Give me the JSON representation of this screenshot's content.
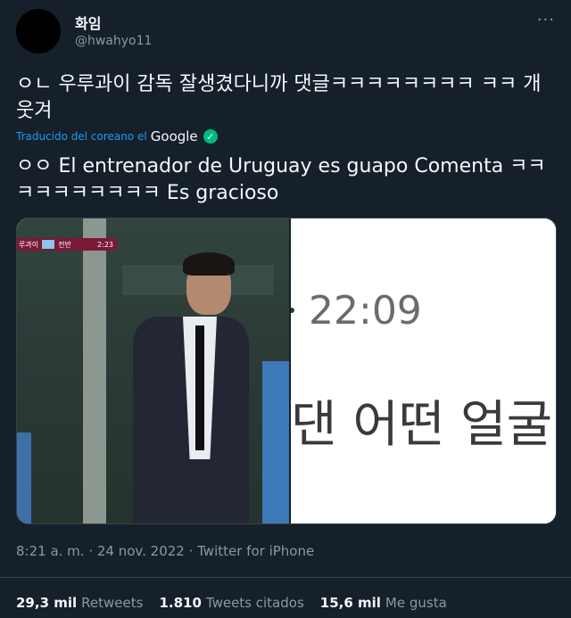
{
  "user": {
    "name": "화임",
    "handle": "@hwahyo11"
  },
  "tweet": {
    "text": "ㅇㄴ 우루과이 감독 잘생겼다니까 댓글ㅋㅋㅋㅋㅋㅋㅋㅋ ㅋㅋ 개웃겨",
    "translated_label": "Traducido del coreano el",
    "translated_provider": "Google",
    "translation": "ㅇㅇ El entrenador de Uruguay es guapo Comenta ㅋㅋ ㅋㅋㅋㅋㅋㅋㅋㅋ Es gracioso"
  },
  "media": {
    "scorebug_teams": "루과이",
    "scorebug_half": "전반",
    "scorebug_time": "2:23",
    "screenshot_clock": "22:09",
    "screenshot_text": "댄 어떤 얼굴"
  },
  "meta": {
    "timestamp": "8:21 a. m. · 24 nov. 2022 · Twitter for iPhone"
  },
  "stats": {
    "retweets_count": "29,3 mil",
    "retweets_label": "Retweets",
    "quotes_count": "1.810",
    "quotes_label": "Tweets citados",
    "likes_count": "15,6 mil",
    "likes_label": "Me gusta"
  },
  "icons": {
    "more": "more-icon",
    "verified": "check-icon"
  },
  "colors": {
    "background": "#15202b",
    "accent": "#1d9bf0",
    "muted": "#8b98a5",
    "verified_green": "#00ba7c"
  }
}
